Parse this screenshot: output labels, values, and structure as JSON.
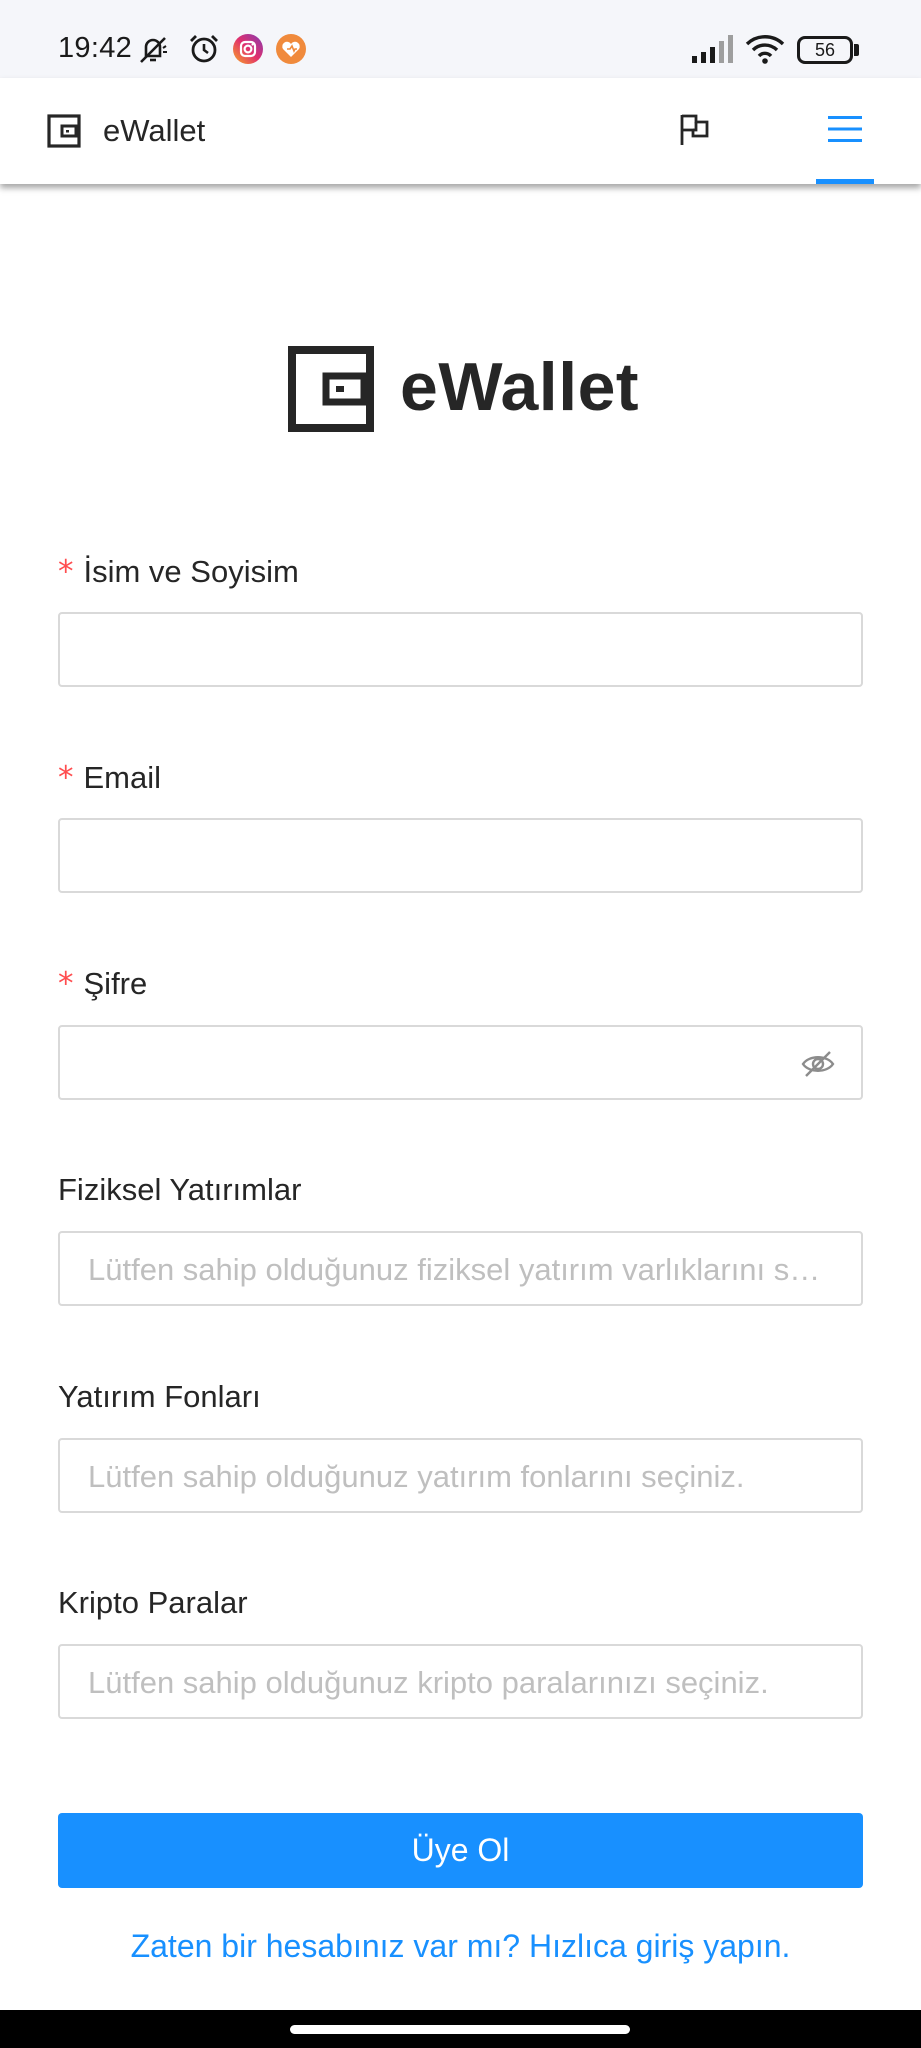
{
  "status_bar": {
    "time": "19:42",
    "battery": "56",
    "icons": [
      "mute-icon",
      "alarm-icon",
      "instagram-icon",
      "app-icon",
      "signal-icon",
      "wifi-icon",
      "battery-icon"
    ]
  },
  "nav": {
    "brand": "eWallet",
    "accent_color": "#1890ff"
  },
  "hero": {
    "title": "eWallet"
  },
  "form": {
    "name": {
      "label": "İsim ve Soyisim",
      "required": true,
      "value": "",
      "placeholder": ""
    },
    "email": {
      "label": "Email",
      "required": true,
      "value": "",
      "placeholder": ""
    },
    "password": {
      "label": "Şifre",
      "required": true,
      "value": "",
      "placeholder": ""
    },
    "physical_investments": {
      "label": "Fiziksel Yatırımlar",
      "placeholder": "Lütfen sahip olduğunuz fiziksel yatırım varlıklarını seçiniz."
    },
    "investment_funds": {
      "label": "Yatırım Fonları",
      "placeholder": "Lütfen sahip olduğunuz yatırım fonlarını seçiniz."
    },
    "crypto": {
      "label": "Kripto Paralar",
      "placeholder": "Lütfen sahip olduğunuz kripto paralarınızı seçiniz."
    },
    "required_mark": "*",
    "submit_label": "Üye Ol",
    "login_link": "Zaten bir hesabınız var mı? Hızlıca giriş yapın."
  }
}
